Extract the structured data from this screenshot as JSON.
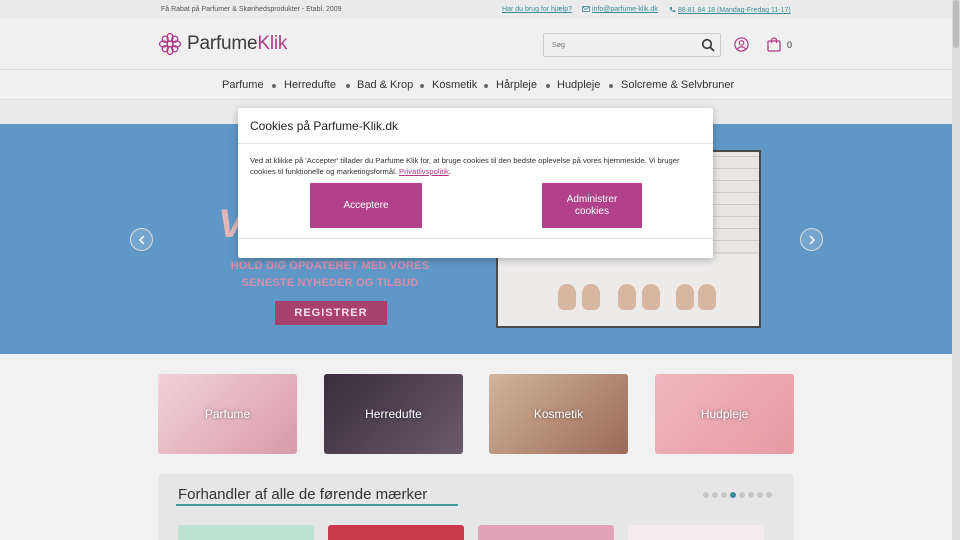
{
  "topbar": {
    "tagline": "Få Rabat på Parfumer & Skønhedsprodukter - Etabl. 2009",
    "help": "Har du brug for hjælp?",
    "email": "info@parfume-klik.dk",
    "phone": "88 81 84 18 (Mandag-Fredag 11-17)"
  },
  "header": {
    "logo_part1": "Parfume",
    "logo_part2": "Klik",
    "search_placeholder": "Søg",
    "cart_count": "0",
    "brand_color": "#b03a8a"
  },
  "nav": {
    "items": [
      "Parfume",
      "Herredufte",
      "Bad & Krop",
      "Kosmetik",
      "Hårpleje",
      "Hudpleje",
      "Solcreme & Selvbruner"
    ]
  },
  "hero": {
    "promo_line1": "HOLD DIG OPDATERET MED VORES",
    "promo_line2": "SENESTE NYHEDER OG TILBUD",
    "register": "REGISTRER"
  },
  "categories": [
    "Parfume",
    "Herredufte",
    "Kosmetik",
    "Hudpleje"
  ],
  "brands": {
    "title": "Forhandler af alle de førende mærker",
    "slides": 8,
    "active_slide": 4
  },
  "cookie": {
    "title": "Cookies på Parfume-Klik.dk",
    "body": "Ved at klikke på 'Accepter' tillader du Parfume Klik for, at bruge cookies til den bedste oplevelse på vores hjemmeside. Vi bruger cookies til funktionelle og marketingsformål.",
    "privacy_link": "Privatlivspolitik",
    "accept": "Acceptere",
    "manage_line1": "Administrer",
    "manage_line2": "cookies"
  }
}
